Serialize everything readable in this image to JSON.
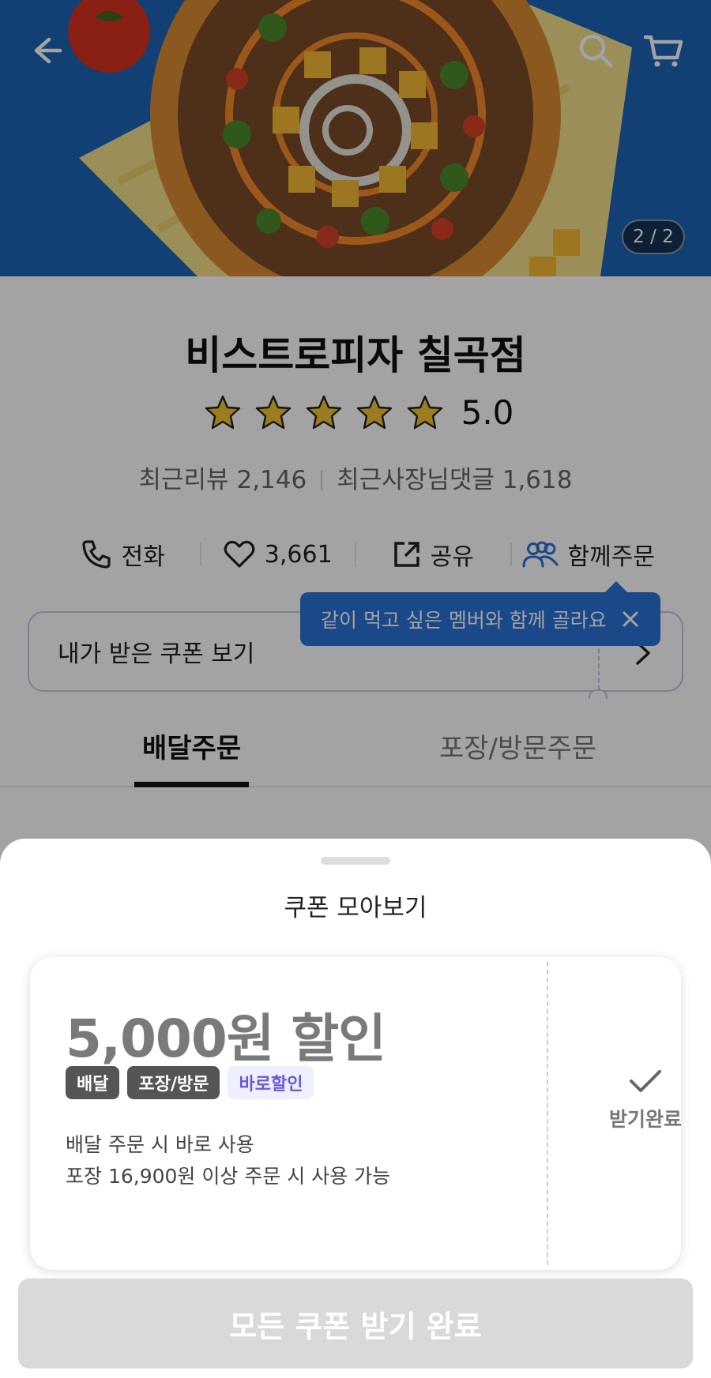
{
  "hero": {
    "page_counter": "2 / 2",
    "back_icon": "back-arrow-icon",
    "search_icon": "search-icon",
    "cart_icon": "cart-icon"
  },
  "store": {
    "name": "비스트로피자 칠곡점",
    "rating": "5.0",
    "star_count": 5,
    "recent_review_label": "최근리뷰",
    "recent_review_count": "2,146",
    "owner_reply_label": "최근사장님댓글",
    "owner_reply_count": "1,618"
  },
  "actions": {
    "call": "전화",
    "like_count": "3,661",
    "share": "공유",
    "group_order": "함께주문"
  },
  "tooltip": {
    "text": "같이 먹고 싶은 멤버와 함께 골라요"
  },
  "coupon_button": {
    "label": "내가 받은 쿠폰 보기"
  },
  "order_tabs": {
    "delivery": "배달주문",
    "pickup": "포장/방문주문"
  },
  "sheet": {
    "title": "쿠폰 모아보기",
    "coupon": {
      "amount": "5,000원 할인",
      "badges": [
        "배달",
        "포장/방문",
        "바로할인"
      ],
      "condition_1": "배달 주문 시 바로 사용",
      "condition_2": "포장 16,900원 이상 주문 시 사용 가능",
      "status": "받기완료"
    },
    "all_button": "모든 쿠폰 받기 완료"
  },
  "colors": {
    "brand_blue": "#2a71d6",
    "star_gold": "#f2c230",
    "coupon_purple": "#6b58d6"
  }
}
